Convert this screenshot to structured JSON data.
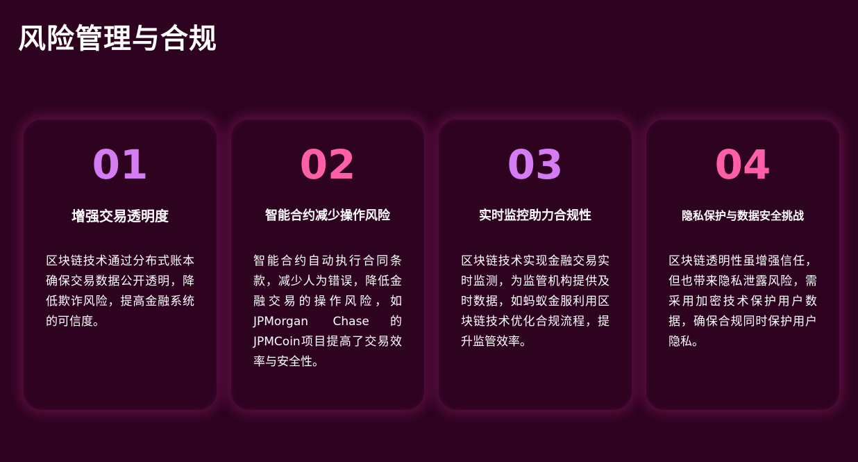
{
  "title": "风险管理与合规",
  "colors": {
    "background": "#2e0320",
    "number_purple": "#d57cf5",
    "number_pink": "#ff5fa8",
    "text": "#ffffff"
  },
  "cards": [
    {
      "number": "01",
      "number_color": "#d57cf5",
      "heading": "增强交易透明度",
      "body": "区块链技术通过分布式账本确保交易数据公开透明，降低欺诈风险，提高金融系统的可信度。"
    },
    {
      "number": "02",
      "number_color": "#ff5fa8",
      "heading": "智能合约减少操作风险",
      "body": "智能合约自动执行合同条款，减少人为错误，降低金融交易的操作风险，如JPMorgan Chase的JPMCoin项目提高了交易效率与安全性。"
    },
    {
      "number": "03",
      "number_color": "#d57cf5",
      "heading": "实时监控助力合规性",
      "body": "区块链技术实现金融交易实时监测，为监管机构提供及时数据，如蚂蚁金服利用区块链技术优化合规流程，提升监管效率。"
    },
    {
      "number": "04",
      "number_color": "#ff5fa8",
      "heading": "隐私保护与数据安全挑战",
      "body": "区块链透明性虽增强信任，但也带来隐私泄露风险，需采用加密技术保护用户数据，确保合规同时保护用户隐私。"
    }
  ]
}
